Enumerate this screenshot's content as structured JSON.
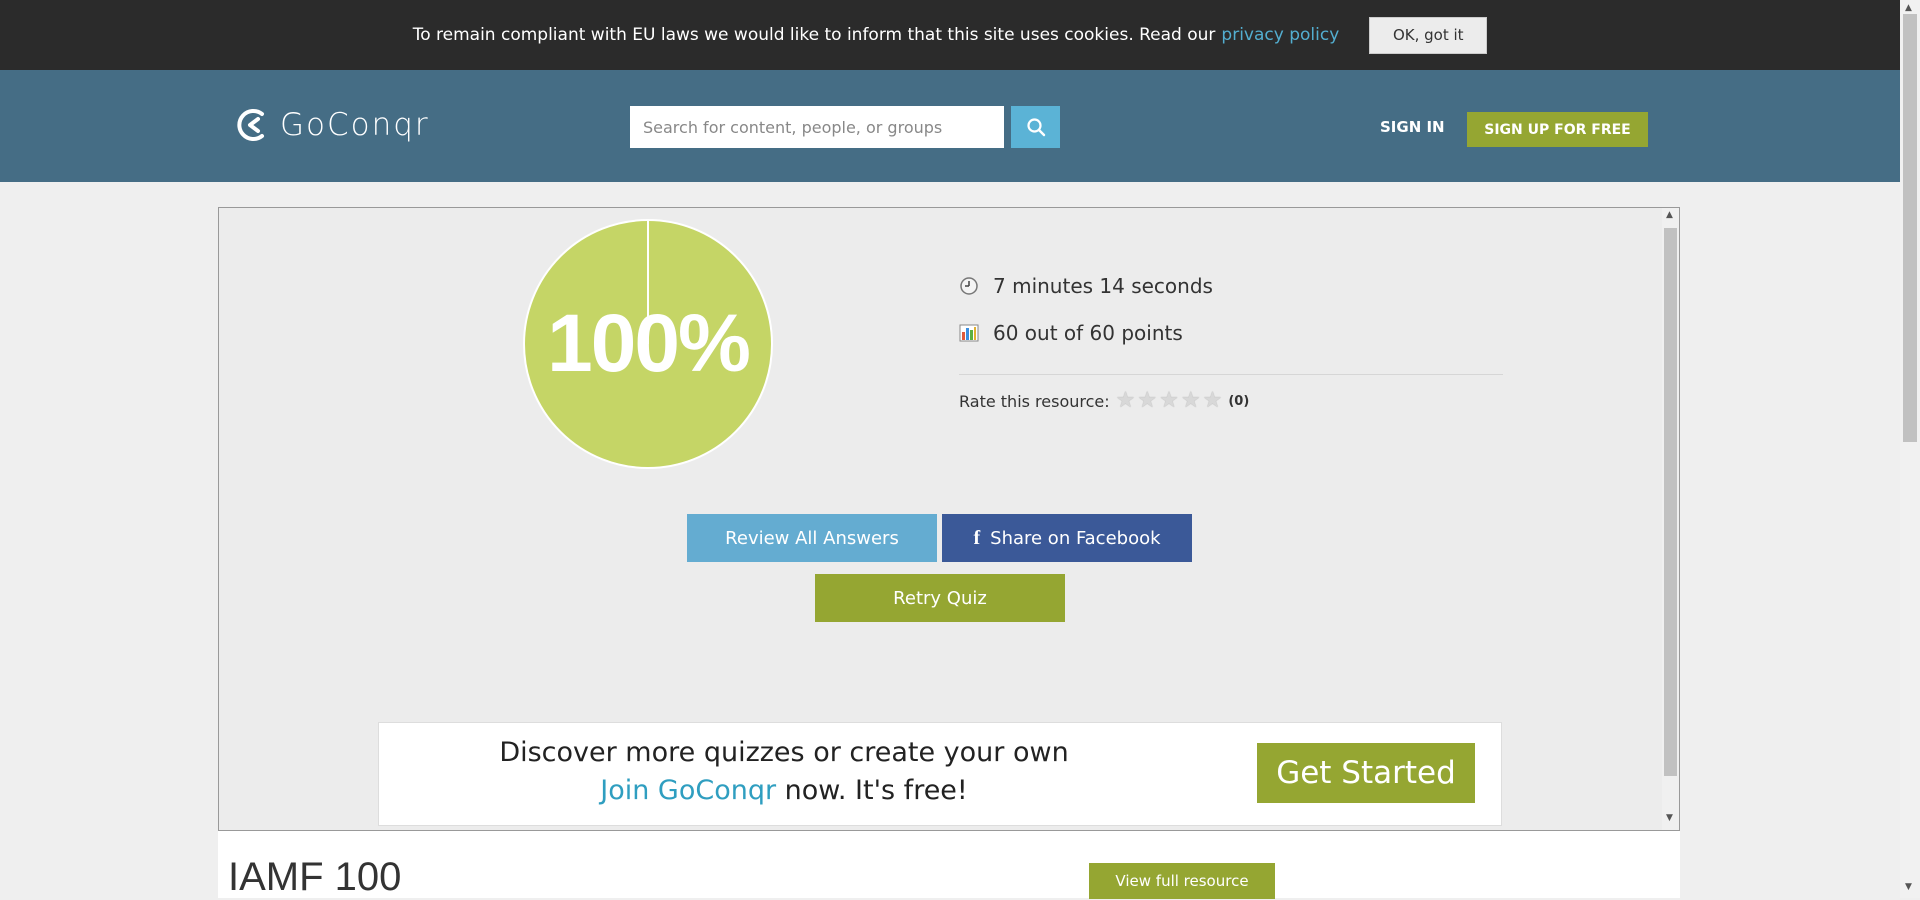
{
  "cookie": {
    "message": "To remain compliant with EU laws we would like to inform that this site uses cookies. Read our",
    "link": "privacy policy",
    "button": "OK, got it"
  },
  "header": {
    "logo_text": "GoConqr",
    "search_placeholder": "Search for content, people, or groups",
    "signin": "SIGN IN",
    "signup": "SIGN UP FOR FREE"
  },
  "result": {
    "score_label": "100%",
    "score_fraction": 1.0,
    "time": "7 minutes 14 seconds",
    "points": "60 out of 60 points",
    "rate_label": "Rate this resource:",
    "rating_stars_filled": 0,
    "rating_count": "(0)"
  },
  "buttons": {
    "review": "Review All Answers",
    "facebook_icon": "f",
    "facebook": "Share on Facebook",
    "retry": "Retry Quiz"
  },
  "promo": {
    "line1": "Discover more quizzes or create your own",
    "join": "Join GoConqr",
    "line2_rest": " now. It's free!",
    "cta": "Get Started"
  },
  "page": {
    "heading": "IAMF 100",
    "view_full": "View full resource"
  },
  "colors": {
    "header": "#456d85",
    "accent_green": "#95a632",
    "pie": "#c5d566",
    "facebook": "#3b5998",
    "review": "#64acd1"
  }
}
